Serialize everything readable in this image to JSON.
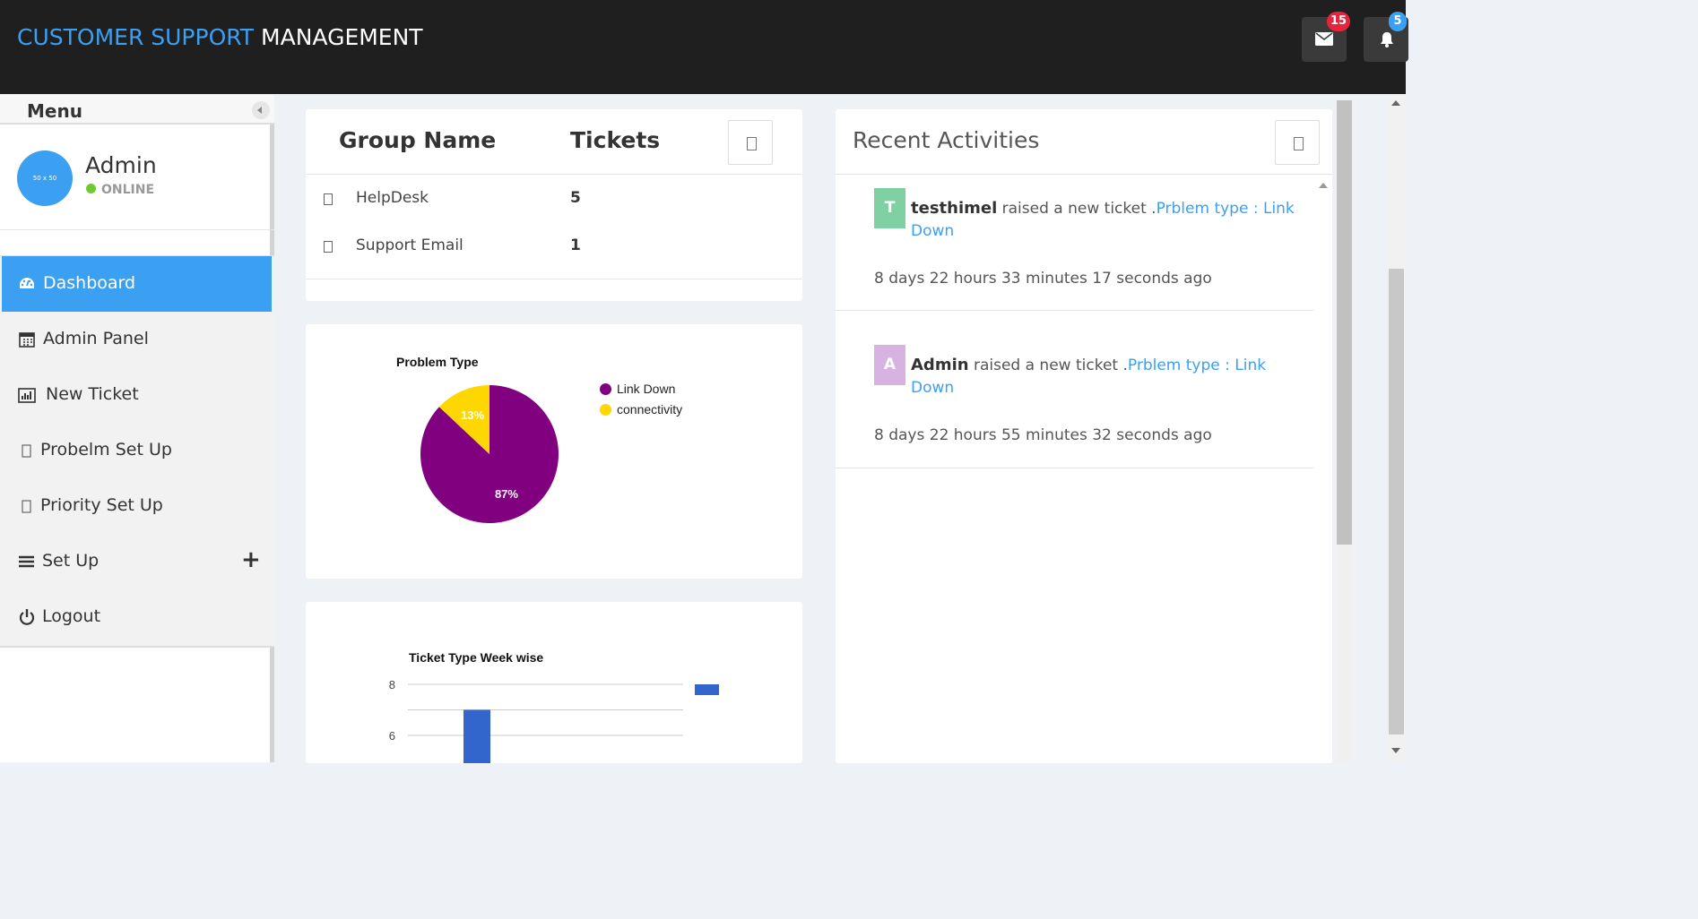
{
  "header": {
    "title_part1": "CUSTOMER SUPPORT",
    "title_part2": "MANAGEMENT",
    "mail_count": "15",
    "notification_count": "5"
  },
  "sidebar": {
    "menu_title": "Menu",
    "avatar_text": "50 x 50",
    "user_name": "Admin",
    "user_status": "ONLINE",
    "items": [
      {
        "label": "Dashboard",
        "icon": "dashboard-icon",
        "active": true
      },
      {
        "label": "Admin Panel",
        "icon": "calendar-icon"
      },
      {
        "label": "New Ticket",
        "icon": "bar-chart-icon"
      },
      {
        "label": "Probelm Set Up",
        "icon": "file-icon"
      },
      {
        "label": "Priority Set Up",
        "icon": "file-icon"
      },
      {
        "label": "Set Up",
        "icon": "bars-icon",
        "expand": "+"
      },
      {
        "label": "Logout",
        "icon": "power-icon"
      }
    ]
  },
  "groups": {
    "col_group": "Group Name",
    "col_tickets": "Tickets",
    "rows": [
      {
        "name": "HelpDesk",
        "tickets": "5"
      },
      {
        "name": "Support Email",
        "tickets": "1"
      }
    ]
  },
  "chart_data": [
    {
      "type": "pie",
      "title": "Problem Type",
      "slices": [
        {
          "label": "Link Down",
          "value": 87,
          "display": "87%",
          "color": "#800080"
        },
        {
          "label": "connectivity",
          "value": 13,
          "display": "13%",
          "color": "#FFD700"
        }
      ],
      "legend": "right"
    },
    {
      "type": "bar",
      "title": "Ticket Type Week wise",
      "yticks": [
        8,
        6
      ],
      "visible_bar_values": [
        7
      ],
      "color": "#3366CC",
      "grid": true,
      "legend": "right"
    }
  ],
  "activities": {
    "title": "Recent Activities",
    "items": [
      {
        "letter": "T",
        "color": "#7fd1a4",
        "user": "testhimel",
        "action": " raised a new ticket .",
        "link": "Prblem type : Link Down",
        "time": "8 days 22 hours 33 minutes 17 seconds ago"
      },
      {
        "letter": "A",
        "color": "#d6b3e0",
        "user": "Admin",
        "action": " raised a new ticket .",
        "link": "Prblem type : Link Down",
        "time": "8 days 22 hours 55 minutes 32 seconds ago"
      }
    ]
  }
}
